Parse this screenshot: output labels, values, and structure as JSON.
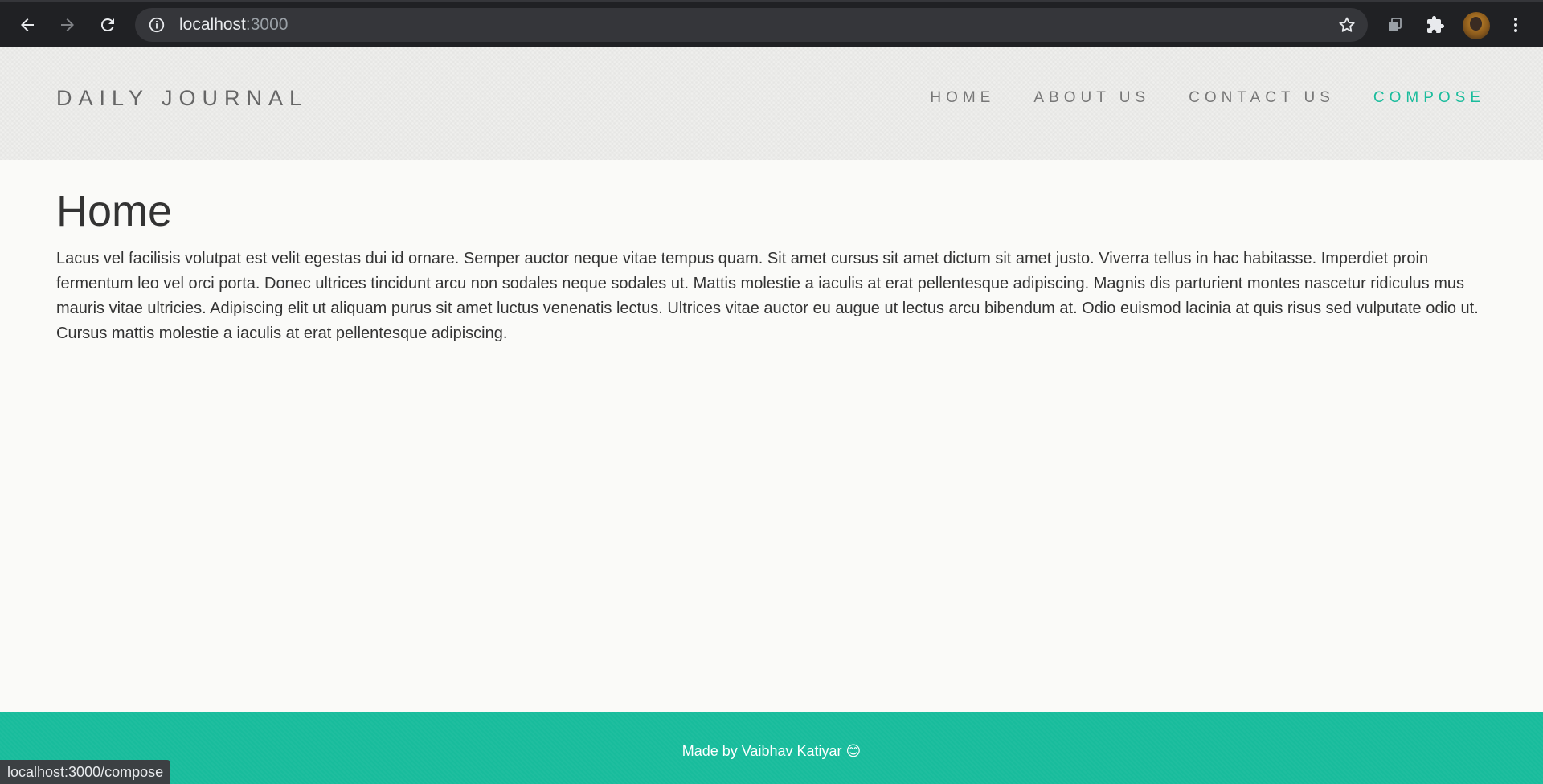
{
  "browser": {
    "url_host": "localhost",
    "url_port": ":3000",
    "status_url": "localhost:3000/compose"
  },
  "site": {
    "brand": "DAILY JOURNAL",
    "nav": {
      "home": "HOME",
      "about": "ABOUT US",
      "contact": "CONTACT US",
      "compose": "COMPOSE"
    },
    "accent_color": "#1abc9c"
  },
  "main": {
    "title": "Home",
    "body": "Lacus vel facilisis volutpat est velit egestas dui id ornare. Semper auctor neque vitae tempus quam. Sit amet cursus sit amet dictum sit amet justo. Viverra tellus in hac habitasse. Imperdiet proin fermentum leo vel orci porta. Donec ultrices tincidunt arcu non sodales neque sodales ut. Mattis molestie a iaculis at erat pellentesque adipiscing. Magnis dis parturient montes nascetur ridiculus mus mauris vitae ultricies. Adipiscing elit ut aliquam purus sit amet luctus venenatis lectus. Ultrices vitae auctor eu augue ut lectus arcu bibendum at. Odio euismod lacinia at quis risus sed vulputate odio ut. Cursus mattis molestie a iaculis at erat pellentesque adipiscing."
  },
  "footer": {
    "text": "Made by Vaibhav Katiyar 😊"
  }
}
